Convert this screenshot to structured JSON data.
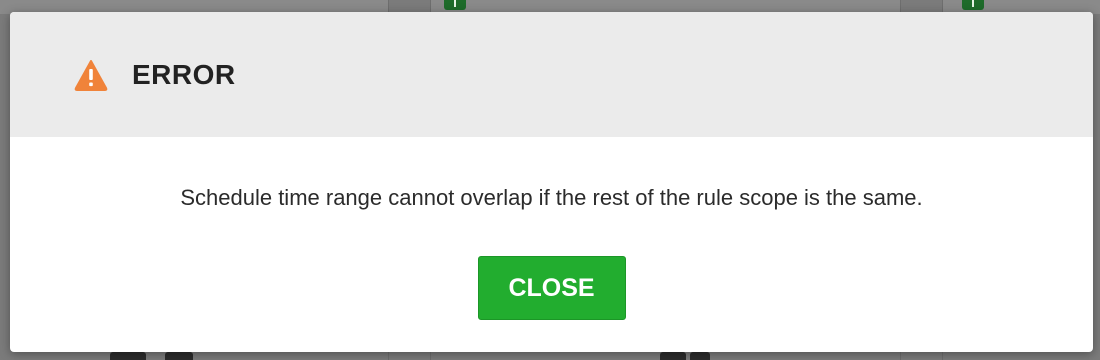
{
  "dialog": {
    "title": "ERROR",
    "message": "Schedule time range cannot overlap if the rest of the rule scope is the same.",
    "close_label": "CLOSE",
    "icon": "warning-icon"
  },
  "colors": {
    "header_bg": "#ebebeb",
    "warning": "#f0833a",
    "button": "#22ad2f",
    "button_text": "#ffffff"
  }
}
